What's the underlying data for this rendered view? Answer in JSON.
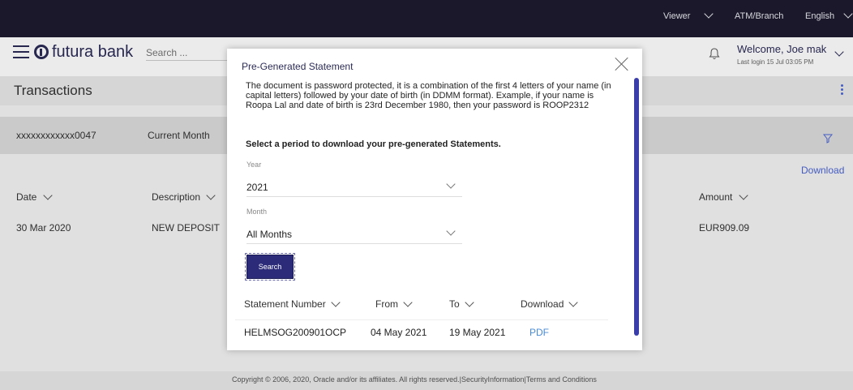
{
  "topbar": {
    "viewer": "Viewer",
    "atm_branch": "ATM/Branch",
    "language": "English"
  },
  "header": {
    "logo_text": "futura bank",
    "search_placeholder": "Search ...",
    "welcome": "Welcome, Joe mak",
    "last_login": "Last login 15 Jul 03:05 PM"
  },
  "page": {
    "title": "Transactions"
  },
  "filter": {
    "account": "xxxxxxxxxxxx0047",
    "period": "Current Month"
  },
  "download_link": "Download",
  "table": {
    "headers": {
      "date": "Date",
      "description": "Description",
      "amount": "Amount"
    },
    "rows": [
      {
        "date": "30 Mar 2020",
        "description": "NEW DEPOSIT",
        "amount": "EUR909.09"
      }
    ]
  },
  "footer": {
    "text": "Copyright © 2006, 2020, Oracle and/or its affiliates. All rights reserved.|SecurityInformation|Terms and Conditions"
  },
  "modal": {
    "title": "Pre-Generated Statement",
    "info": "The document is password protected, it is a combination of the first 4 letters of your name (in capital letters) followed by your date of birth (in DDMM format). Example, if your name is Roopa Lal and date of birth is 23rd December 1980, then your password is ROOP2312",
    "instruction": "Select a period to download your pre-generated Statements.",
    "year_label": "Year",
    "year_value": "2021",
    "month_label": "Month",
    "month_value": "All Months",
    "search_button": "Search",
    "columns": {
      "statement_number": "Statement Number",
      "from": "From",
      "to": "To",
      "download": "Download"
    },
    "rows": [
      {
        "statement_number": "HELMSOG200901OCP",
        "from": "04 May 2021",
        "to": "19 May 2021",
        "download": "PDF"
      }
    ]
  }
}
